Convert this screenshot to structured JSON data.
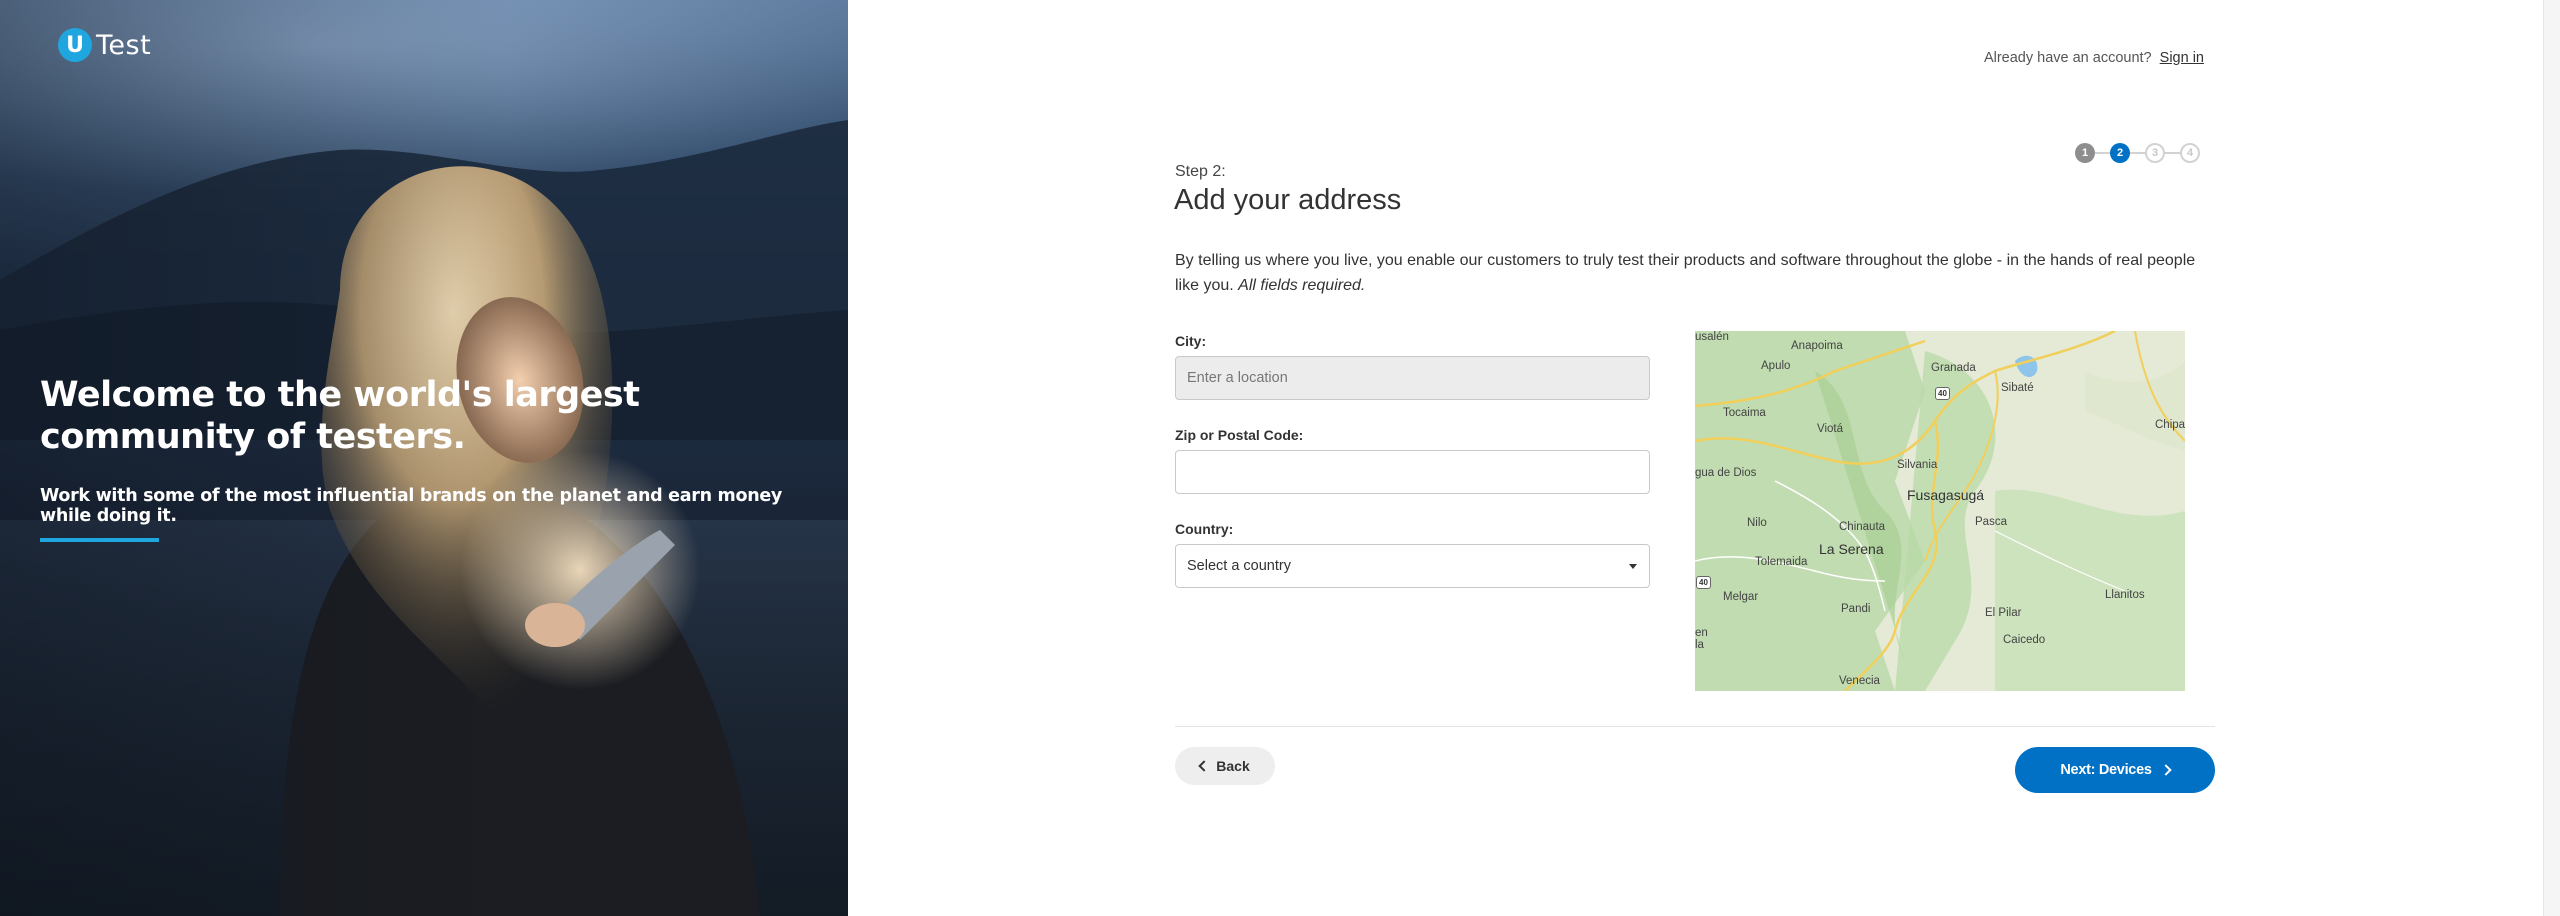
{
  "hero": {
    "logo_letter": "U",
    "logo_text": "Test",
    "title": "Welcome to the world's largest community of testers.",
    "subtitle": "Work with some of the most influential brands on the planet and earn money while doing it."
  },
  "header": {
    "signin_prompt": "Already have an account?",
    "signin_link": "Sign in"
  },
  "steps": {
    "items": [
      {
        "number": "1",
        "state": "done"
      },
      {
        "number": "2",
        "state": "active"
      },
      {
        "number": "3",
        "state": "todo"
      },
      {
        "number": "4",
        "state": "todo"
      }
    ]
  },
  "form": {
    "step_label": "Step 2:",
    "title": "Add your address",
    "intro": "By telling us where you live, you enable our customers to truly test their products and software throughout the globe - in the hands of real people like you.",
    "intro_emphasis": "All fields required.",
    "city_label": "City:",
    "city_placeholder": "Enter a location",
    "zip_label": "Zip or Postal Code:",
    "zip_value": "",
    "country_label": "Country:",
    "country_selected": "Select a country",
    "back_label": "Back",
    "next_label": "Next: Devices"
  },
  "map": {
    "places": [
      "usalén",
      "Anapoima",
      "Apulo",
      "Granada",
      "Sibaté",
      "Tocaima",
      "Viotá",
      "Chipa",
      "Silvania",
      "Fusagasugá",
      "gua de Dios",
      "Nilo",
      "Chinauta",
      "Pasca",
      "La Serena",
      "Tolemaida",
      "Melgar",
      "Pandi",
      "El Pilar",
      "Llanitos",
      "Caicedo",
      "Venecia",
      "en",
      "la"
    ],
    "road_shields": [
      "40",
      "40"
    ]
  },
  "colors": {
    "accent": "#1fa6de",
    "primary": "#0071c5",
    "step_done": "#8e8e8e"
  }
}
